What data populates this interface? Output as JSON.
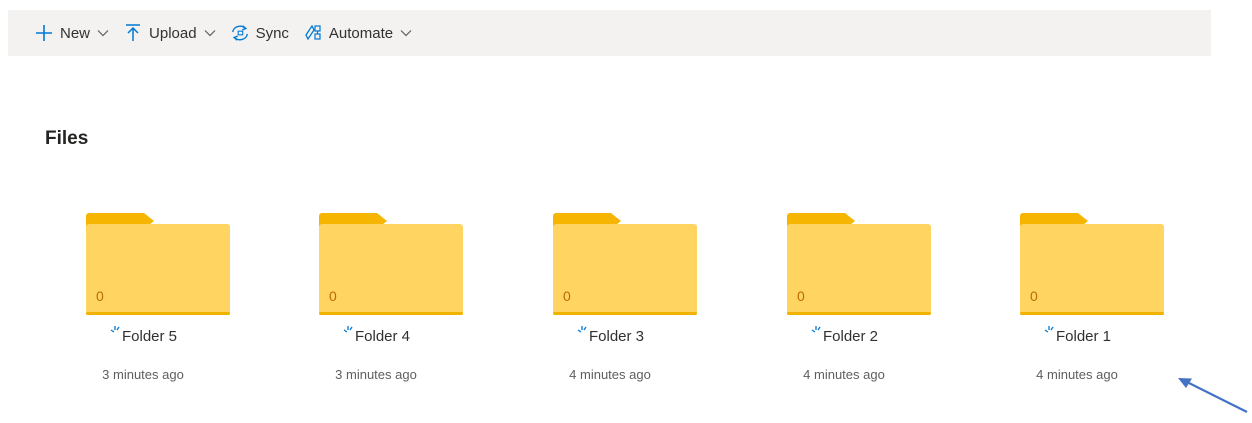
{
  "toolbar": {
    "new_label": "New",
    "upload_label": "Upload",
    "sync_label": "Sync",
    "automate_label": "Automate",
    "icons": [
      "plus-icon",
      "upload-icon",
      "sync-icon",
      "automate-icon",
      "chevron-down-icon"
    ]
  },
  "section": {
    "title": "Files"
  },
  "folders": [
    {
      "count": "0",
      "name": "Folder 5",
      "modified": "3 minutes ago"
    },
    {
      "count": "0",
      "name": "Folder 4",
      "modified": "3 minutes ago"
    },
    {
      "count": "0",
      "name": "Folder 3",
      "modified": "4 minutes ago"
    },
    {
      "count": "0",
      "name": "Folder 2",
      "modified": "4 minutes ago"
    },
    {
      "count": "0",
      "name": "Folder 1",
      "modified": "4 minutes ago"
    }
  ],
  "colors": {
    "accent": "#0078d4",
    "folder_back": "#f6b500",
    "folder_front": "#ffd461",
    "toolbar_bg": "#f3f2f1",
    "annotation_arrow": "#4472c4"
  }
}
